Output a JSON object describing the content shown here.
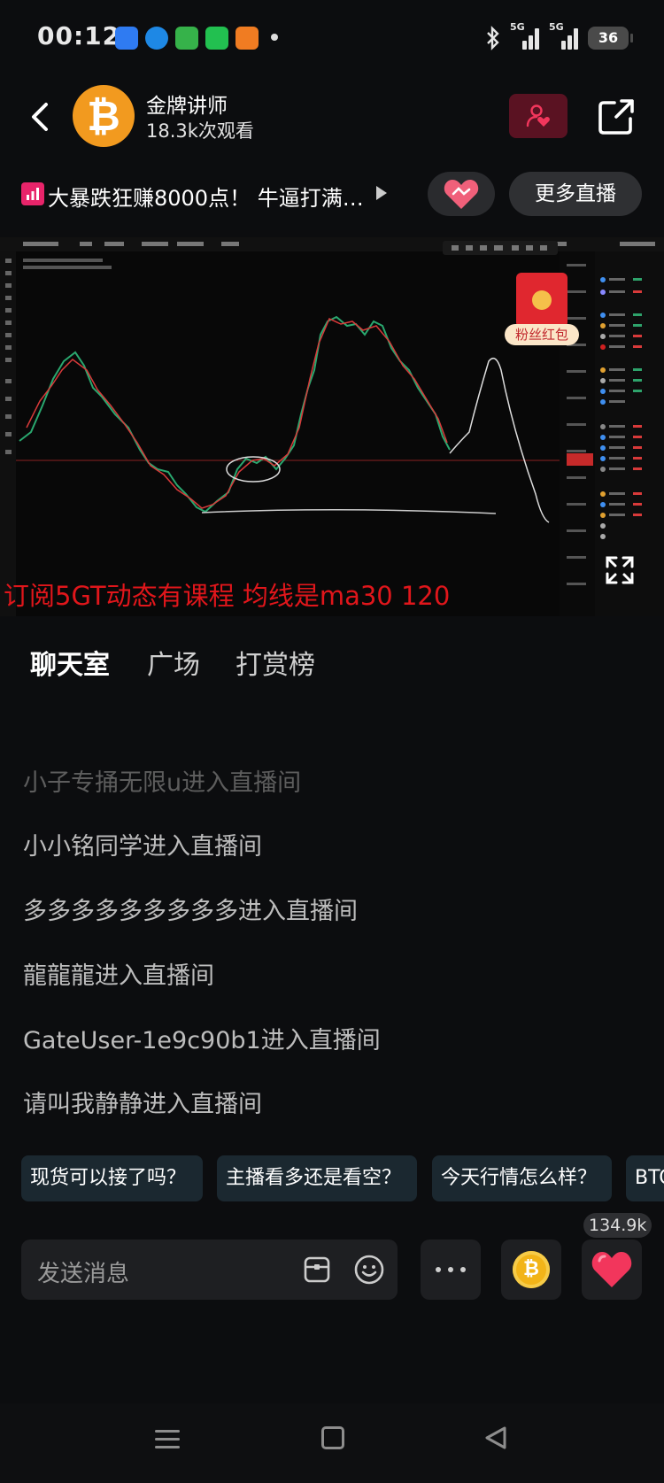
{
  "status_bar": {
    "time": "00:12",
    "signal1": "5G",
    "signal2": "5G",
    "battery": "36"
  },
  "header": {
    "streamer_name": "金牌讲师",
    "viewers": "18.3k次观看"
  },
  "topic": {
    "text": "大暴跌狂赚8000点！ 牛逼打满…",
    "more_live": "更多直播"
  },
  "video": {
    "caption": "订阅5GT动态有课程   均线是ma30 120",
    "red_packet_label": "粉丝红包"
  },
  "tabs": [
    {
      "label": "聊天室"
    },
    {
      "label": "广场"
    },
    {
      "label": "打赏榜"
    }
  ],
  "chat": [
    {
      "text": "小子专捅无限u进入直播间"
    },
    {
      "text": "小小铭同学进入直播间"
    },
    {
      "text": "多多多多多多多多多进入直播间"
    },
    {
      "text": "龍龍龍进入直播间"
    },
    {
      "text": "GateUser-1e9c90b1进入直播间"
    },
    {
      "text": "请叫我静静进入直播间"
    }
  ],
  "quick_replies": [
    {
      "label": "现货可以接了吗？"
    },
    {
      "label": "主播看多还是看空？"
    },
    {
      "label": "今天行情怎么样？"
    },
    {
      "label": "BTC"
    }
  ],
  "input": {
    "placeholder": "发送消息",
    "like_count": "134.9k",
    "coin_symbol": "₿"
  },
  "colors": {
    "background": "#0c0d0f",
    "caption_red": "#e0161b",
    "bitcoin_orange": "#f29a1f",
    "like_pink": "#f2365c"
  }
}
